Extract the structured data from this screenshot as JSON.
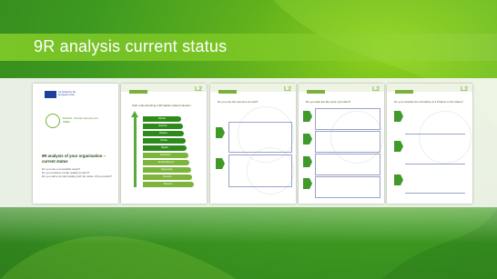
{
  "slide": {
    "title": "9R analysis current status",
    "colors": {
      "green_dark": "#2e7f1c",
      "green_light": "#8fd11e",
      "band": "#7ec828"
    }
  },
  "pages": [
    {
      "kind": "cover",
      "eu_text": "Co-funded by the European Union",
      "logo_text": "Rethink, circular economy for SMEs",
      "doc_title": "9R analysis of your organisation – current status",
      "bullets": [
        "Do you use a renewable asset?",
        "Do you produce a high quality product?",
        "Do you sell a circular quality and the value of the product?"
      ]
    },
    {
      "kind": "ladder",
      "tag": "Step",
      "heading": "Start understanding a 9R ladder-related situation",
      "levels": [
        "Refuse",
        "Rethink",
        "Reduce",
        "Reuse",
        "Repair",
        "Refurbish",
        "Remanufacture",
        "Repurpose",
        "Recycle",
        "Recover"
      ]
    },
    {
      "kind": "form",
      "tag": "Step",
      "heading": "Do you use the resource as well?"
    },
    {
      "kind": "form",
      "tag": "Step",
      "heading": "Do you take the life cycle of product?"
    },
    {
      "kind": "form",
      "tag": "Step",
      "heading": "Do you consider the circularity of a Product or the Value?"
    }
  ]
}
